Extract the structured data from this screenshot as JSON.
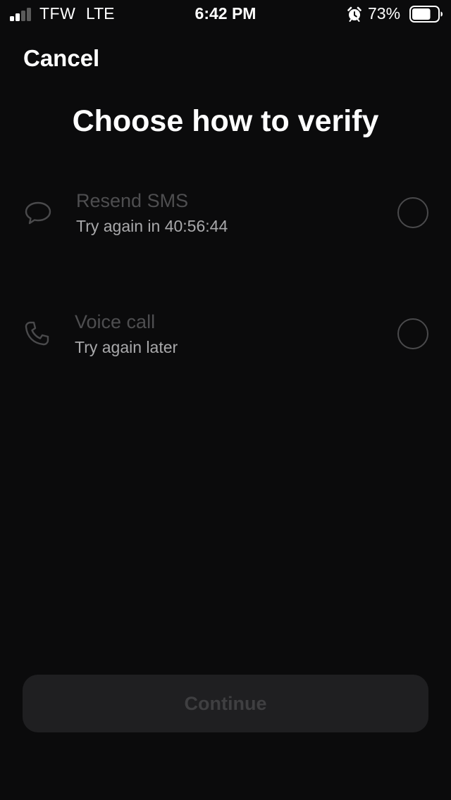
{
  "status_bar": {
    "carrier": "TFW",
    "network": "LTE",
    "time": "6:42 PM",
    "battery_percent": "73%",
    "battery_level": 0.73,
    "signal_bars_filled": 2,
    "signal_bars_total": 4,
    "icons": [
      "signal-icon",
      "alarm-icon",
      "battery-icon"
    ]
  },
  "nav": {
    "cancel_label": "Cancel"
  },
  "title": "Choose how to verify",
  "options": [
    {
      "icon": "chat-bubble-icon",
      "title": "Resend SMS",
      "subtitle": "Try again in 40:56:44",
      "selected": false
    },
    {
      "icon": "phone-icon",
      "title": "Voice call",
      "subtitle": "Try again later",
      "selected": false
    }
  ],
  "continue_label": "Continue",
  "colors": {
    "background": "#0b0b0c",
    "text_primary": "#ffffff",
    "text_disabled": "#4e4e50",
    "text_secondary": "#a9a9ab",
    "button_disabled_bg": "#1f1f21",
    "button_disabled_text": "#3f3f41"
  }
}
